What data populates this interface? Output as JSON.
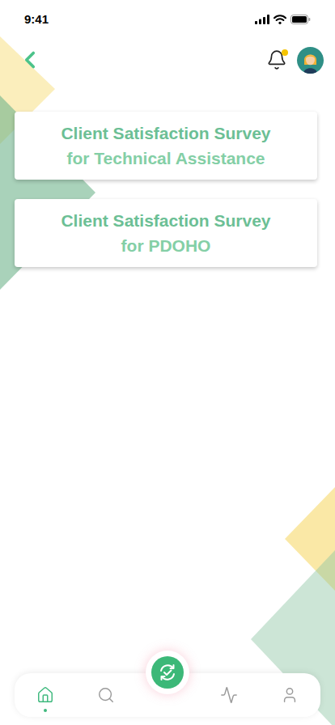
{
  "status_bar": {
    "time": "9:41"
  },
  "header": {
    "notifications_unread": true
  },
  "cards": [
    {
      "lines": [
        "Client Satisfaction Survey",
        "for Technical Assistance"
      ]
    },
    {
      "lines": [
        "Client Satisfaction Survey",
        "for PDOHO"
      ]
    }
  ],
  "nav": [
    {
      "kind": "home",
      "selected": true
    },
    {
      "kind": "search",
      "selected": false
    },
    {
      "kind": "action",
      "selected": false
    },
    {
      "kind": "activity",
      "selected": false
    },
    {
      "kind": "profile",
      "selected": false
    }
  ]
}
